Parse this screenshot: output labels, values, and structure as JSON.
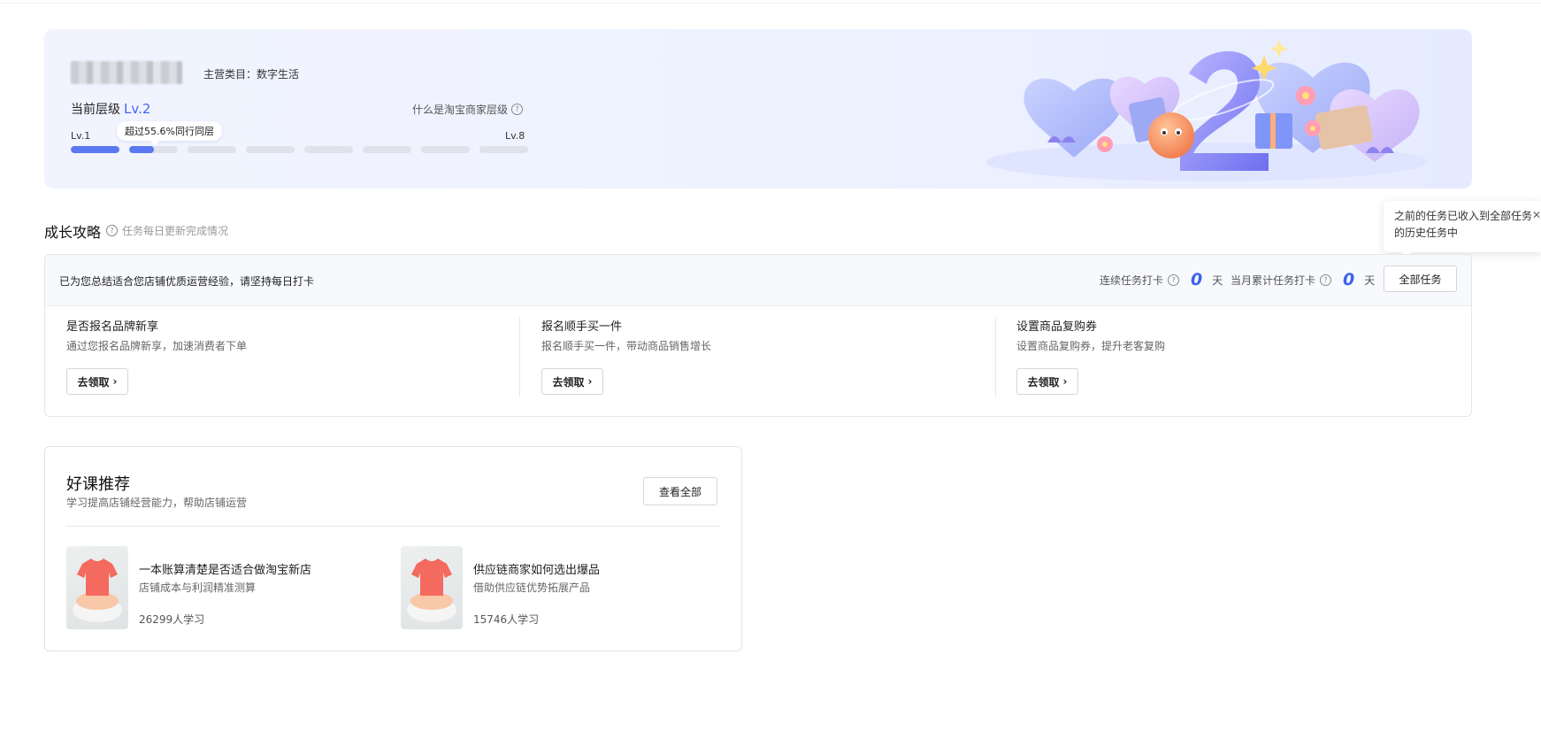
{
  "level_card": {
    "category": "主营类目：数字生活",
    "current_level_label": "当前层级",
    "current_level_value": "Lv.2",
    "what_is_level": "什么是淘宝商家层级",
    "lv_min": "Lv.1",
    "lv_max": "Lv.8",
    "percentile_tip": "超过55.6%同行同层",
    "total_levels": 8,
    "completed_levels": 1,
    "current_level_progress": 0.5
  },
  "growth": {
    "title": "成长攻略",
    "subtitle": "任务每日更新完成情况",
    "tooltip": "之前的任务已收入到全部任务的历史任务中",
    "note": "已为您总结适合您店铺优质运营经验，请坚持每日打卡",
    "streak_label": "连续任务打卡",
    "streak_value": "0",
    "streak_unit": "天",
    "month_label": "当月累计任务打卡",
    "month_value": "0",
    "month_unit": "天",
    "all_tasks_button": "全部任务",
    "tasks": [
      {
        "title": "是否报名品牌新享",
        "desc": "通过您报名品牌新享，加速消费者下单",
        "button": "去领取"
      },
      {
        "title": "报名顺手买一件",
        "desc": "报名顺手买一件，带动商品销售增长",
        "button": "去领取"
      },
      {
        "title": "设置商品复购券",
        "desc": "设置商品复购券，提升老客复购",
        "button": "去领取"
      }
    ]
  },
  "courses": {
    "title": "好课推荐",
    "subtitle": "学习提高店铺经营能力，帮助店铺运营",
    "view_all_button": "查看全部",
    "items": [
      {
        "name": "一本账算清楚是否适合做淘宝新店",
        "desc": "店铺成本与利润精准测算",
        "learners": "26299人学习"
      },
      {
        "name": "供应链商家如何选出爆品",
        "desc": "借助供应链优势拓展产品",
        "learners": "15746人学习"
      }
    ]
  },
  "colors": {
    "accent": "#3b62f0",
    "progress_fill": "#5a78f0",
    "progress_empty": "#dfe2ea"
  }
}
